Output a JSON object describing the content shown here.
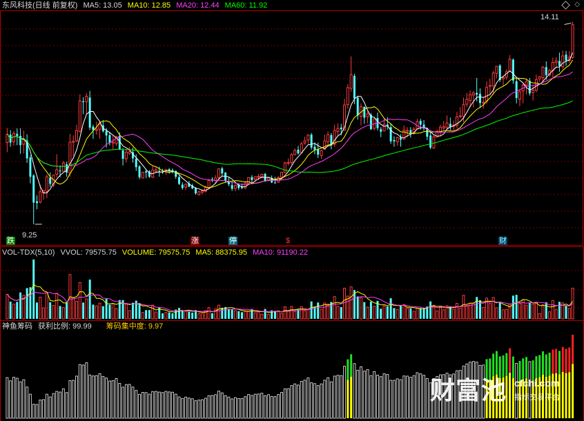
{
  "header": {
    "title": "东风科技(日线 前复权)",
    "ma5": "MA5: 13.05",
    "ma10": "MA10: 12.85",
    "ma20": "MA20: 12.44",
    "ma60": "MA60: 11.92",
    "menu_icon": "diamond-menu-icon"
  },
  "price_panel": {
    "high_label": "14.11",
    "low_label": "9.25",
    "signals": [
      {
        "text": "跌",
        "kind": "down"
      },
      {
        "text": "涨",
        "kind": "up"
      },
      {
        "text": "停",
        "kind": "limit"
      },
      {
        "text": "$",
        "kind": "money"
      },
      {
        "text": "财",
        "kind": "finance"
      }
    ]
  },
  "volume_panel": {
    "name": "VOL-TDX(5,10)",
    "vvol": "VVOL: 79575.75",
    "volume": "VOLUME: 79575.75",
    "ma5": "MA5: 88375.95",
    "ma10": "MA10: 91190.22"
  },
  "chip_panel": {
    "name": "神鱼筹码",
    "profit": "获利比例: 99.99",
    "concentration": "筹码集中度: 9.97"
  },
  "watermark": {
    "main": "财富池",
    "domain": "cfchi.com",
    "tagline": "指标交易平台"
  },
  "colors": {
    "up": "#ff3c3c",
    "down": "#54ffff",
    "ma5": "#ffffff",
    "ma10": "#ffff00",
    "ma20": "#ff40ff",
    "ma60": "#00ff00",
    "grid": "#7a0000",
    "border": "#b40000"
  },
  "chart_data": {
    "type": "candlestick",
    "price_axis_range": [
      9.25,
      14.11
    ],
    "price_series": [
      "MA5",
      "MA10",
      "MA20",
      "MA60"
    ],
    "volume_series": [
      "VOLUME",
      "MA5",
      "MA10"
    ],
    "chip_series": [
      "获利比例",
      "筹码集中度"
    ],
    "last": {
      "MA5": 13.05,
      "MA10": 12.85,
      "MA20": 12.44,
      "MA60": 11.92,
      "VOLUME": 79575.75,
      "VOL_MA5": 88375.95,
      "VOL_MA10": 91190.22,
      "profit_ratio": 99.99,
      "concentration": 9.97
    },
    "candles": [
      [
        11.21,
        11.56,
        10.98,
        11.41
      ],
      [
        11.4,
        11.51,
        11.11,
        11.21
      ],
      [
        11.23,
        11.49,
        11.14,
        11.43
      ],
      [
        11.42,
        11.55,
        11.15,
        11.37
      ],
      [
        11.37,
        11.55,
        10.94,
        11.15
      ],
      [
        11.17,
        11.5,
        10.95,
        11.28
      ],
      [
        11.26,
        11.41,
        10.72,
        10.83
      ],
      [
        10.85,
        10.91,
        10.23,
        10.39
      ],
      [
        10.42,
        10.45,
        9.25,
        9.77
      ],
      [
        9.8,
        9.94,
        9.61,
        9.76
      ],
      [
        9.78,
        10.2,
        9.75,
        10.03
      ],
      [
        10.0,
        10.07,
        9.84,
        10.06
      ],
      [
        10.04,
        10.44,
        9.88,
        10.39
      ],
      [
        10.37,
        10.49,
        10.14,
        10.22
      ],
      [
        10.19,
        10.43,
        10.14,
        10.43
      ],
      [
        10.45,
        10.93,
        10.37,
        10.56
      ],
      [
        10.54,
        10.66,
        10.38,
        10.52
      ],
      [
        10.52,
        10.77,
        10.52,
        10.72
      ],
      [
        10.69,
        10.75,
        10.39,
        10.49
      ],
      [
        10.48,
        11.42,
        10.39,
        11.22
      ],
      [
        11.22,
        11.38,
        10.89,
        11.24
      ],
      [
        11.25,
        11.64,
        11.22,
        11.5
      ],
      [
        11.48,
        12.37,
        11.45,
        12.21
      ],
      [
        12.2,
        12.3,
        11.89,
        12.18
      ],
      [
        12.19,
        12.4,
        11.89,
        12.32
      ],
      [
        12.29,
        12.45,
        11.51,
        11.57
      ],
      [
        11.59,
        11.64,
        11.3,
        11.51
      ],
      [
        11.5,
        11.71,
        11.4,
        11.53
      ],
      [
        11.53,
        11.68,
        11.3,
        11.65
      ],
      [
        11.62,
        11.75,
        11.45,
        11.48
      ],
      [
        11.49,
        11.56,
        11.09,
        11.38
      ],
      [
        11.39,
        11.47,
        11.14,
        11.2
      ],
      [
        11.2,
        11.38,
        11.03,
        11.22
      ],
      [
        11.19,
        11.37,
        11.13,
        11.35
      ],
      [
        11.37,
        11.46,
        11.03,
        11.05
      ],
      [
        11.02,
        11.08,
        10.66,
        10.82
      ],
      [
        10.82,
        11.06,
        10.73,
        10.98
      ],
      [
        10.95,
        11.1,
        10.91,
        10.99
      ],
      [
        10.98,
        11.09,
        10.73,
        10.83
      ],
      [
        10.82,
        10.93,
        10.53,
        10.62
      ],
      [
        10.64,
        10.67,
        10.33,
        10.38
      ],
      [
        10.36,
        10.5,
        10.36,
        10.5
      ],
      [
        10.52,
        10.55,
        10.36,
        10.49
      ],
      [
        10.52,
        10.55,
        10.36,
        10.39
      ],
      [
        10.38,
        10.66,
        10.36,
        10.55
      ],
      [
        10.52,
        10.62,
        10.47,
        10.56
      ],
      [
        10.53,
        10.63,
        10.39,
        10.52
      ],
      [
        10.51,
        10.58,
        10.46,
        10.49
      ],
      [
        10.51,
        10.58,
        10.44,
        10.56
      ],
      [
        10.57,
        10.6,
        10.46,
        10.53
      ],
      [
        10.55,
        10.59,
        10.47,
        10.51
      ],
      [
        10.53,
        10.54,
        10.34,
        10.39
      ],
      [
        10.38,
        10.42,
        10.19,
        10.22
      ],
      [
        10.2,
        10.26,
        10.08,
        10.12
      ],
      [
        10.14,
        10.23,
        10.07,
        10.21
      ],
      [
        10.23,
        10.29,
        10.14,
        10.15
      ],
      [
        10.18,
        10.22,
        10.09,
        10.11
      ],
      [
        10.11,
        10.14,
        9.96,
        9.99
      ],
      [
        9.96,
        10.05,
        9.94,
        10.03
      ],
      [
        10.02,
        10.08,
        9.97,
        10.05
      ],
      [
        10.04,
        10.18,
        10.01,
        10.14
      ],
      [
        10.11,
        10.33,
        10.09,
        10.3
      ],
      [
        10.33,
        10.38,
        10.26,
        10.31
      ],
      [
        10.3,
        10.43,
        10.22,
        10.36
      ],
      [
        10.37,
        10.59,
        10.29,
        10.58
      ],
      [
        10.59,
        10.63,
        10.39,
        10.47
      ],
      [
        10.49,
        10.5,
        10.25,
        10.3
      ],
      [
        10.28,
        10.37,
        10.16,
        10.21
      ],
      [
        10.19,
        10.25,
        10.05,
        10.1
      ],
      [
        10.11,
        10.21,
        10.04,
        10.18
      ],
      [
        10.2,
        10.23,
        10.07,
        10.12
      ],
      [
        10.15,
        10.23,
        10.09,
        10.12
      ],
      [
        10.12,
        10.26,
        10.1,
        10.24
      ],
      [
        10.23,
        10.38,
        10.21,
        10.37
      ],
      [
        10.38,
        10.43,
        10.22,
        10.31
      ],
      [
        10.33,
        10.4,
        10.27,
        10.39
      ],
      [
        10.38,
        10.46,
        10.31,
        10.4
      ],
      [
        10.37,
        10.46,
        10.36,
        10.45
      ],
      [
        10.46,
        10.48,
        10.27,
        10.29
      ],
      [
        10.31,
        10.38,
        10.28,
        10.36
      ],
      [
        10.36,
        10.42,
        10.24,
        10.25
      ],
      [
        10.25,
        10.39,
        10.22,
        10.24
      ],
      [
        10.26,
        10.41,
        10.24,
        10.37
      ],
      [
        10.38,
        10.5,
        10.38,
        10.5
      ],
      [
        10.49,
        10.75,
        10.48,
        10.72
      ],
      [
        10.71,
        10.83,
        10.66,
        10.73
      ],
      [
        10.73,
        10.96,
        10.68,
        10.92
      ],
      [
        10.92,
        11.07,
        10.9,
        11.02
      ],
      [
        11.04,
        11.13,
        10.92,
        10.95
      ],
      [
        10.97,
        11.23,
        10.95,
        11.18
      ],
      [
        11.2,
        11.35,
        11.16,
        11.25
      ],
      [
        11.27,
        11.41,
        11.18,
        11.39
      ],
      [
        11.4,
        11.44,
        11.04,
        11.09
      ],
      [
        11.11,
        11.21,
        10.93,
        11.04
      ],
      [
        11.05,
        11.21,
        10.84,
        10.92
      ],
      [
        10.9,
        11.04,
        10.82,
        11.02
      ],
      [
        11.05,
        11.4,
        11.03,
        11.25
      ],
      [
        11.23,
        11.48,
        11.13,
        11.4
      ],
      [
        11.39,
        11.44,
        11.05,
        11.15
      ],
      [
        11.17,
        11.64,
        11.11,
        11.5
      ],
      [
        11.48,
        11.67,
        11.37,
        11.55
      ],
      [
        11.57,
        11.66,
        11.38,
        11.53
      ],
      [
        11.51,
        12.26,
        11.49,
        12.11
      ],
      [
        12.12,
        12.61,
        12.02,
        12.53
      ],
      [
        12.51,
        13.28,
        12.43,
        12.84
      ],
      [
        12.81,
        12.86,
        12.13,
        12.27
      ],
      [
        12.29,
        12.31,
        11.76,
        11.86
      ],
      [
        11.84,
        12.15,
        11.62,
        12.07
      ],
      [
        12.07,
        12.07,
        11.66,
        11.81
      ],
      [
        11.83,
        11.96,
        11.67,
        11.9
      ],
      [
        11.88,
        11.92,
        11.51,
        11.53
      ],
      [
        11.55,
        11.81,
        11.5,
        11.78
      ],
      [
        11.8,
        11.93,
        11.5,
        11.56
      ],
      [
        11.53,
        11.58,
        11.34,
        11.47
      ],
      [
        11.49,
        11.79,
        11.48,
        11.65
      ],
      [
        11.64,
        11.82,
        11.52,
        11.6
      ],
      [
        11.58,
        11.66,
        11.18,
        11.24
      ],
      [
        11.27,
        11.36,
        11.11,
        11.24
      ],
      [
        11.23,
        11.35,
        11.13,
        11.33
      ],
      [
        11.33,
        11.41,
        11.11,
        11.28
      ],
      [
        11.29,
        11.62,
        11.28,
        11.51
      ],
      [
        11.48,
        11.58,
        11.33,
        11.5
      ],
      [
        11.51,
        11.58,
        11.33,
        11.43
      ],
      [
        11.43,
        11.58,
        11.4,
        11.53
      ],
      [
        11.54,
        11.78,
        11.52,
        11.71
      ],
      [
        11.73,
        11.78,
        11.52,
        11.64
      ],
      [
        11.64,
        11.75,
        11.49,
        11.55
      ],
      [
        11.55,
        11.56,
        11.27,
        11.35
      ],
      [
        11.38,
        11.45,
        11.05,
        11.09
      ],
      [
        11.08,
        11.38,
        11.06,
        11.35
      ],
      [
        11.34,
        11.52,
        11.33,
        11.48
      ],
      [
        11.46,
        11.64,
        11.35,
        11.58
      ],
      [
        11.56,
        11.73,
        11.51,
        11.59
      ],
      [
        11.57,
        11.86,
        11.54,
        11.68
      ],
      [
        11.66,
        11.81,
        11.51,
        11.58
      ],
      [
        11.6,
        11.74,
        11.51,
        11.63
      ],
      [
        11.62,
        11.94,
        11.56,
        11.83
      ],
      [
        11.84,
        12.06,
        11.8,
        11.85
      ],
      [
        11.84,
        12.29,
        11.7,
        12.12
      ],
      [
        12.13,
        12.4,
        12.06,
        12.25
      ],
      [
        12.22,
        12.46,
        12.06,
        12.36
      ],
      [
        12.35,
        12.45,
        12.05,
        12.4
      ],
      [
        12.4,
        12.76,
        12.2,
        12.36
      ],
      [
        12.38,
        12.51,
        12.04,
        12.16
      ],
      [
        12.16,
        12.31,
        12.02,
        12.18
      ],
      [
        12.2,
        12.68,
        12.14,
        12.54
      ],
      [
        12.56,
        12.74,
        12.34,
        12.58
      ],
      [
        12.57,
        12.93,
        12.36,
        12.88
      ],
      [
        12.87,
        13.05,
        12.75,
        13.04
      ],
      [
        13.06,
        13.09,
        12.66,
        12.71
      ],
      [
        12.74,
        12.81,
        12.57,
        12.77
      ],
      [
        12.78,
        12.97,
        12.72,
        12.91
      ],
      [
        12.92,
        13.31,
        12.91,
        13.21
      ],
      [
        13.2,
        13.23,
        12.62,
        12.7
      ],
      [
        12.68,
        12.76,
        12.15,
        12.28
      ],
      [
        12.25,
        12.48,
        12.08,
        12.43
      ],
      [
        12.45,
        12.65,
        12.15,
        12.59
      ],
      [
        12.59,
        12.73,
        12.37,
        12.67
      ],
      [
        12.69,
        12.76,
        12.34,
        12.39
      ],
      [
        12.41,
        12.6,
        12.22,
        12.47
      ],
      [
        12.46,
        12.84,
        12.42,
        12.72
      ],
      [
        12.74,
        12.81,
        12.67,
        12.79
      ],
      [
        12.77,
        13.05,
        12.67,
        13.02
      ],
      [
        13.02,
        13.16,
        12.72,
        12.83
      ],
      [
        12.83,
        12.98,
        12.79,
        12.94
      ],
      [
        12.94,
        13.25,
        12.75,
        13.13
      ],
      [
        13.13,
        13.26,
        13.0,
        13.17
      ],
      [
        13.17,
        13.37,
        12.91,
        13.05
      ],
      [
        13.03,
        13.42,
        12.98,
        13.29
      ],
      [
        13.32,
        13.41,
        13.05,
        13.18
      ],
      [
        13.18,
        13.41,
        13.12,
        13.26
      ],
      [
        13.25,
        14.11,
        13.22,
        14.04
      ]
    ]
  }
}
